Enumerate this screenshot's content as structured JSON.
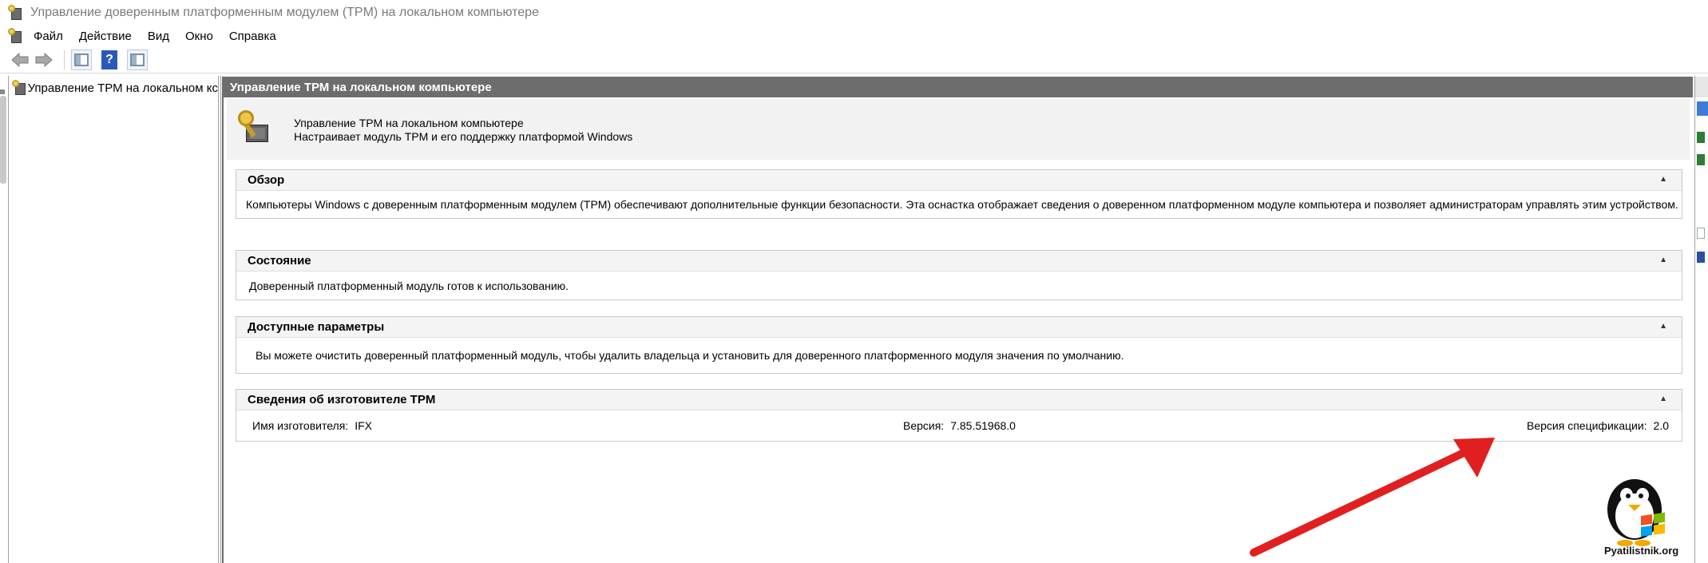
{
  "window": {
    "title": "Управление доверенным платформенным модулем (TPM) на локальном компьютере"
  },
  "menu": {
    "items": [
      "Файл",
      "Действие",
      "Вид",
      "Окно",
      "Справка"
    ]
  },
  "toolbar": {
    "back_icon": "back-arrow-icon",
    "forward_icon": "forward-arrow-icon",
    "help_label": "?"
  },
  "tree": {
    "root_label": "Управление ТРМ на локальном кс"
  },
  "center": {
    "header_title": "Управление ТРМ на локальном компьютере",
    "intro_title": "Управление ТРМ на локальном компьютере",
    "intro_subtitle": "Настраивает модуль TPM и его поддержку платформой Windows",
    "sections": {
      "overview": {
        "title": "Обзор",
        "body": "Компьютеры Windows с доверенным платформенным модулем (TPM) обеспечивают дополнительные функции безопасности. Эта оснастка отображает сведения о доверенном платформенном модуле компьютера и позволяет администраторам управлять этим устройством."
      },
      "status": {
        "title": "Состояние",
        "body": "Доверенный платформенный модуль готов к использованию."
      },
      "options": {
        "title": "Доступные параметры",
        "body": "Вы можете очистить доверенный платформенный модуль, чтобы удалить владельца и установить для доверенного платформенного модуля значения по умолчанию."
      },
      "vendor": {
        "title": "Сведения об изготовителе TPM",
        "manufacturer_label": "Имя изготовителя:",
        "manufacturer_value": "IFX",
        "version_label": "Версия:",
        "version_value": "7.85.51968.0",
        "spec_label": "Версия спецификации:",
        "spec_value": "2.0"
      }
    },
    "collapse_glyph": "▲"
  },
  "watermark": {
    "text": "Pyatilistnik.org"
  },
  "colors": {
    "pane_header_bg": "#6d6d6d",
    "arrow": "#e02020",
    "help_icon_bg": "#2a5ab8"
  }
}
